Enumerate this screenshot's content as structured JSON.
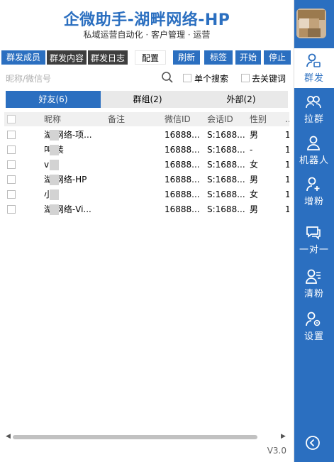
{
  "header": {
    "title": "企微助手-湖畔网络-HP",
    "subtitle": "私域运营自动化 · 客户管理 · 运营"
  },
  "tabs": {
    "members": "群发成员",
    "content": "群发内容",
    "log": "群发日志",
    "config": "配置",
    "refresh": "刷新",
    "tags": "标签",
    "start": "开始",
    "stop": "停止"
  },
  "search": {
    "placeholder": "昵称/微信号",
    "single_search": "单个搜索",
    "keyword": "去关键词"
  },
  "subtabs": [
    "好友(6)",
    "群组(2)",
    "外部(2)"
  ],
  "table": {
    "headers": [
      "昵称",
      "备注",
      "微信ID",
      "会话ID",
      "性别",
      "..."
    ],
    "rows": [
      {
        "nickname": "湖  网络-项...",
        "remark": "",
        "wxid": "16888...",
        "session": "S:1688...",
        "gender": "男",
        "extra": "1"
      },
      {
        "nickname": "叫  装",
        "remark": "",
        "wxid": "16888...",
        "session": "S:1688...",
        "gender": "-",
        "extra": "1"
      },
      {
        "nickname": "v",
        "remark": "",
        "wxid": "16888...",
        "session": "S:1688...",
        "gender": "女",
        "extra": "1"
      },
      {
        "nickname": "湖  网络-HP",
        "remark": "",
        "wxid": "16888...",
        "session": "S:1688...",
        "gender": "男",
        "extra": "1"
      },
      {
        "nickname": "小",
        "remark": "",
        "wxid": "16888...",
        "session": "S:1688...",
        "gender": "女",
        "extra": "1"
      },
      {
        "nickname": "湖  网络-Vi...",
        "remark": "",
        "wxid": "16888...",
        "session": "S:1688...",
        "gender": "男",
        "extra": "1"
      }
    ]
  },
  "footer": {
    "version": "V3.0"
  },
  "sidebar": {
    "items": [
      "群发",
      "拉群",
      "机器人",
      "增粉",
      "一对一",
      "清粉",
      "设置"
    ]
  },
  "colors": {
    "brand": "#2b6fc0",
    "dark_tab": "#3e3e3e"
  }
}
